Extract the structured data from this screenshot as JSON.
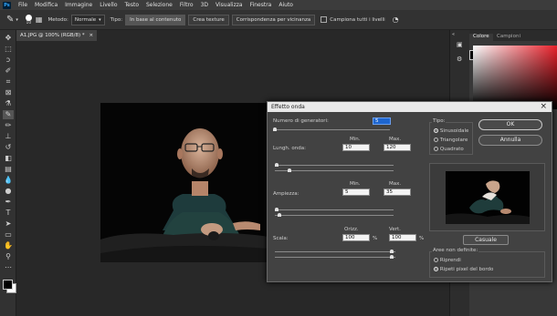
{
  "app": {
    "logo": "Ps"
  },
  "menu": [
    "File",
    "Modifica",
    "Immagine",
    "Livello",
    "Testo",
    "Selezione",
    "Filtro",
    "3D",
    "Visualizza",
    "Finestra",
    "Aiuto"
  ],
  "options": {
    "size": "10",
    "metodo_label": "Metodo:",
    "metodo_value": "Normale",
    "tipo_label": "Tipo:",
    "btn_content": "In base al contenuto",
    "btn_texture": "Crea texture",
    "btn_match": "Corrispondenza per vicinanza",
    "sample_all": "Campiona tutti i livelli"
  },
  "document": {
    "tab_title": "A1.JPG @ 100% (RGB/8) *",
    "close": "×"
  },
  "panels": {
    "tab_colore": "Colore",
    "tab_campioni": "Campioni"
  },
  "dialog": {
    "title": "Effetto onda",
    "close": "×",
    "num_generators_label": "Numero di generatori:",
    "num_generators_value": "5",
    "min_label": "Min.",
    "max_label": "Max.",
    "wavelength_label": "Lungh. onda:",
    "wavelength_min": "10",
    "wavelength_max": "120",
    "amplitude_label": "Ampiezza:",
    "amplitude_min": "5",
    "amplitude_max": "35",
    "scale_label": "Scala:",
    "horiz_label": "Orizz.",
    "vert_label": "Vert.",
    "scale_h": "100",
    "scale_v": "100",
    "percent": "%",
    "type_label": "Tipo:",
    "type_options": [
      "Sinusoidale",
      "Triangolare",
      "Quadrato"
    ],
    "type_selected": 0,
    "ok": "OK",
    "cancel": "Annulla",
    "random": "Casuale",
    "undefined_label": "Aree non definite:",
    "undefined_options": [
      "Riprendi",
      "Ripeti pixel del bordo"
    ],
    "undefined_selected": 1
  },
  "colors": {
    "accent": "#31a8ff",
    "dialog_bg": "#424242"
  }
}
